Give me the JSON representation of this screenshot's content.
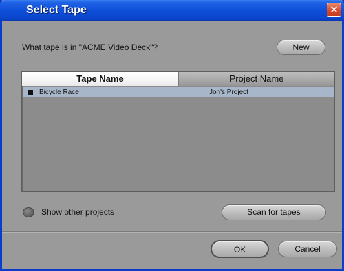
{
  "window": {
    "title": "Select Tape",
    "close_glyph": "✕"
  },
  "prompt": "What tape is in \"ACME Video Deck\"?",
  "buttons": {
    "new_label": "New",
    "scan_label": "Scan for tapes",
    "ok_label": "OK",
    "cancel_label": "Cancel"
  },
  "table": {
    "columns": [
      "Tape Name",
      "Project Name"
    ],
    "rows": [
      {
        "tape": "Bicycle Race",
        "project": "Jon's Project",
        "selected": true
      }
    ]
  },
  "options": {
    "show_other_projects_label": "Show other projects",
    "show_other_projects_checked": false
  },
  "colors": {
    "titlebar": "#0b47cf",
    "dialog_bg": "#9a9a9a",
    "selected_row": "#a8b6c9",
    "close_button": "#d5492a"
  }
}
